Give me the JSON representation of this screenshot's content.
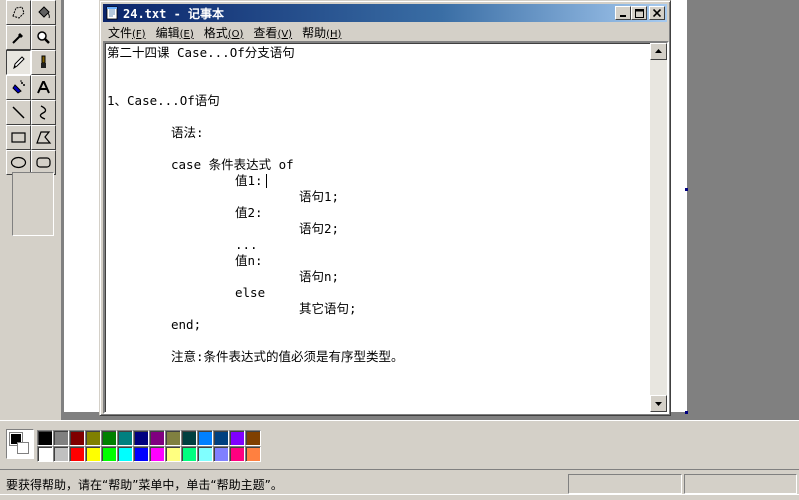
{
  "notepad": {
    "title": "24.txt - 记事本",
    "menu": [
      {
        "label": "文件",
        "accel": "(F)"
      },
      {
        "label": "编辑",
        "accel": "(E)"
      },
      {
        "label": "格式",
        "accel": "(O)"
      },
      {
        "label": "查看",
        "accel": "(V)"
      },
      {
        "label": "帮助",
        "accel": "(H)"
      }
    ],
    "lines": {
      "l1": "第二十四课 Case...Of分支语句",
      "l2": "1、Case...Of语句",
      "l3": "语法:",
      "l4": "case 条件表达式 of",
      "l5": "值1:",
      "l6": "语句1;",
      "l7": "值2:",
      "l8": "语句2;",
      "l9": "...",
      "l10": "值n:",
      "l11": "语句n;",
      "l12": "else",
      "l13": "其它语句;",
      "l14": "end;",
      "l15": "注意:条件表达式的值必须是有序型类型。"
    }
  },
  "paint": {
    "tools": [
      "free-select-icon",
      "fill-icon",
      "eyedropper-icon",
      "magnifier-icon",
      "pencil-icon",
      "brush-icon",
      "airbrush-icon",
      "text-icon",
      "line-icon",
      "curve-icon",
      "rectangle-icon",
      "polygon-icon",
      "ellipse-icon",
      "rounded-rectangle-icon"
    ],
    "active_tool": "pencil-icon",
    "palette_colors": [
      "#000000",
      "#808080",
      "#800000",
      "#808000",
      "#008000",
      "#008080",
      "#000080",
      "#800080",
      "#808040",
      "#004040",
      "#0080ff",
      "#004080",
      "#8000ff",
      "#804000",
      "#ffffff",
      "#c0c0c0",
      "#ff0000",
      "#ffff00",
      "#00ff00",
      "#00ffff",
      "#0000ff",
      "#ff00ff",
      "#ffff80",
      "#00ff80",
      "#80ffff",
      "#8080ff",
      "#ff0080",
      "#ff8040"
    ],
    "foreground_color": "#000000",
    "background_color": "#ffffff",
    "status_text": "要获得帮助，请在“帮助”菜单中，单击“帮助主题”。"
  }
}
